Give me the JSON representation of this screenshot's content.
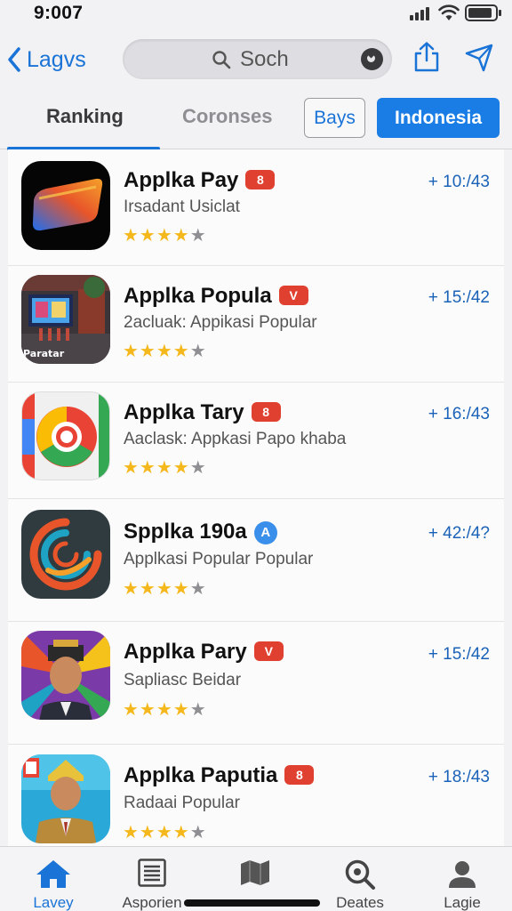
{
  "status": {
    "time": "9:007"
  },
  "nav": {
    "back_label": "Lagvs",
    "search_placeholder": "Soch"
  },
  "tabs": {
    "items": [
      {
        "label": "Ranking",
        "selected": true
      },
      {
        "label": "Coronses",
        "selected": false
      }
    ],
    "filter_bays": "Bays",
    "filter_indonesia": "Indonesia"
  },
  "apps": [
    {
      "name": "Applka Pay",
      "badge": "8",
      "subtitle": "Irsadant Usiclat",
      "rating": 4,
      "rank": "+ 10:/43"
    },
    {
      "name": "Applka Popula",
      "badge": "V",
      "subtitle": "2acluak: Appikasi Popular",
      "rating": 4,
      "rank": "+ 15:/42",
      "icon_caption": "Paratar"
    },
    {
      "name": "Applka Tary",
      "badge": "8",
      "subtitle": "Aaclask: Appkasi Papo khaba",
      "rating": 4,
      "rank": "+ 16:/43"
    },
    {
      "name": "Spplka 190a",
      "badge": "A",
      "subtitle": "Applkasi Popular Popular",
      "rating": 4,
      "rank": "+ 42:/4?"
    },
    {
      "name": "Applka Pary",
      "badge": "V",
      "subtitle": "Sapliasc Beidar",
      "rating": 4,
      "rank": "+ 15:/42"
    },
    {
      "name": "Applka Paputia",
      "badge": "8",
      "subtitle": "Radaai Popular",
      "rating": 4,
      "rank": "+ 18:/43"
    }
  ],
  "bottom_tabs": [
    {
      "label": "Lavey",
      "icon": "home-icon",
      "active": true
    },
    {
      "label": "Asporien",
      "icon": "list-icon",
      "active": false
    },
    {
      "label": "",
      "icon": "map-icon",
      "active": false
    },
    {
      "label": "Deates",
      "icon": "search-icon",
      "active": false
    },
    {
      "label": "Lagie",
      "icon": "person-icon",
      "active": false
    }
  ],
  "colors": {
    "accent": "#1a73d6",
    "badge_red": "#e0402f",
    "star": "#f5b81c"
  }
}
